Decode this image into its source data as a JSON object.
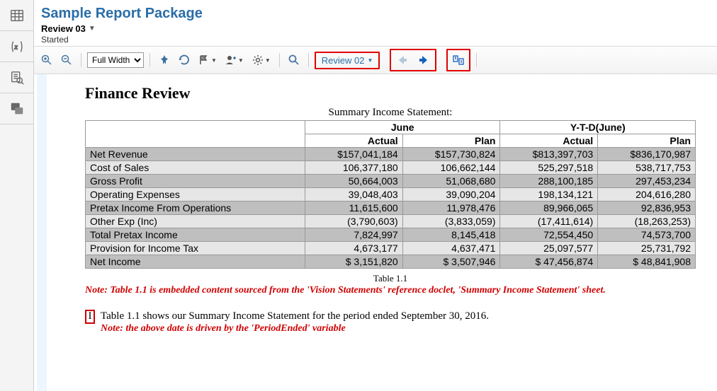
{
  "header": {
    "package_title": "Sample Report Package",
    "review_label": "Review 03",
    "status": "Started"
  },
  "toolbar": {
    "zoom_value": "Full Width",
    "review_dropdown": "Review 02"
  },
  "document": {
    "title": "Finance Review",
    "table_caption": "Summary Income Statement:",
    "columns_group": [
      "June",
      "Y-T-D(June)"
    ],
    "columns_sub": [
      "Actual",
      "Plan",
      "Actual",
      "Plan"
    ],
    "rows": [
      {
        "label": "Net Revenue",
        "vals": [
          "$157,041,184",
          "$157,730,824",
          "$813,397,703",
          "$836,170,987"
        ],
        "cls": "row-a"
      },
      {
        "label": "Cost of Sales",
        "vals": [
          "106,377,180",
          "106,662,144",
          "525,297,518",
          "538,717,753"
        ],
        "cls": "row-b"
      },
      {
        "label": "Gross Profit",
        "vals": [
          "50,664,003",
          "51,068,680",
          "288,100,185",
          "297,453,234"
        ],
        "cls": "row-a"
      },
      {
        "label": "Operating Expenses",
        "vals": [
          "39,048,403",
          "39,090,204",
          "198,134,121",
          "204,616,280"
        ],
        "cls": "row-b"
      },
      {
        "label": "Pretax Income From Operations",
        "vals": [
          "11,615,600",
          "11,978,476",
          "89,966,065",
          "92,836,953"
        ],
        "cls": "row-a"
      },
      {
        "label": "Other Exp (Inc)",
        "vals": [
          "(3,790,603)",
          "(3,833,059)",
          "(17,411,614)",
          "(18,263,253)"
        ],
        "cls": "row-b"
      },
      {
        "label": "Total Pretax Income",
        "vals": [
          "7,824,997",
          "8,145,418",
          "72,554,450",
          "74,573,700"
        ],
        "cls": "row-a"
      },
      {
        "label": "Provision for Income Tax",
        "vals": [
          "4,673,177",
          "4,637,471",
          "25,097,577",
          "25,731,792"
        ],
        "cls": "row-b"
      },
      {
        "label": "Net Income",
        "vals": [
          "$  3,151,820",
          "$  3,507,946",
          "$ 47,456,874",
          "$ 48,841,908"
        ],
        "cls": "row-a"
      }
    ],
    "table_id": "Table 1.1",
    "note1": "Note: Table 1.1 is embedded content sourced from the 'Vision Statements' reference doclet, 'Summary Income Statement' sheet.",
    "insert_marker": "I",
    "desc": "Table 1.1 shows our Summary Income Statement for the period ended September 30, 2016.",
    "note2": "Note: the above date is driven by the 'PeriodEnded' variable"
  },
  "chart_data": {
    "type": "table",
    "title": "Summary Income Statement",
    "columns": [
      "June Actual",
      "June Plan",
      "Y-T-D(June) Actual",
      "Y-T-D(June) Plan"
    ],
    "rows": [
      {
        "label": "Net Revenue",
        "values": [
          157041184,
          157730824,
          813397703,
          836170987
        ]
      },
      {
        "label": "Cost of Sales",
        "values": [
          106377180,
          106662144,
          525297518,
          538717753
        ]
      },
      {
        "label": "Gross Profit",
        "values": [
          50664003,
          51068680,
          288100185,
          297453234
        ]
      },
      {
        "label": "Operating Expenses",
        "values": [
          39048403,
          39090204,
          198134121,
          204616280
        ]
      },
      {
        "label": "Pretax Income From Operations",
        "values": [
          11615600,
          11978476,
          89966065,
          92836953
        ]
      },
      {
        "label": "Other Exp (Inc)",
        "values": [
          -3790603,
          -3833059,
          -17411614,
          -18263253
        ]
      },
      {
        "label": "Total Pretax Income",
        "values": [
          7824997,
          8145418,
          72554450,
          74573700
        ]
      },
      {
        "label": "Provision for Income Tax",
        "values": [
          4673177,
          4637471,
          25097577,
          25731792
        ]
      },
      {
        "label": "Net Income",
        "values": [
          3151820,
          3507946,
          47456874,
          48841908
        ]
      }
    ]
  }
}
